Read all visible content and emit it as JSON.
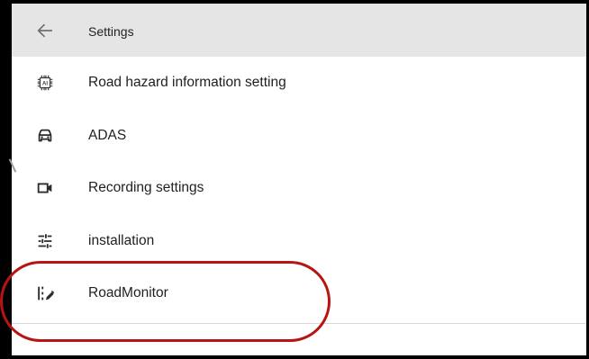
{
  "header": {
    "title": "Settings",
    "back_icon": "arrow-left-icon"
  },
  "menu": [
    {
      "label": "Road hazard information setting",
      "icon": "ai-chip-icon"
    },
    {
      "label": "ADAS",
      "icon": "car-icon"
    },
    {
      "label": "Recording settings",
      "icon": "video-camera-icon"
    },
    {
      "label": "installation",
      "icon": "sliders-icon"
    },
    {
      "label": "RoadMonitor",
      "icon": "road-edit-icon",
      "highlighted": true
    }
  ],
  "colors": {
    "appbar": "#e5e5e5",
    "highlight_ring": "#b81414",
    "icon": "#3a3a3a"
  }
}
